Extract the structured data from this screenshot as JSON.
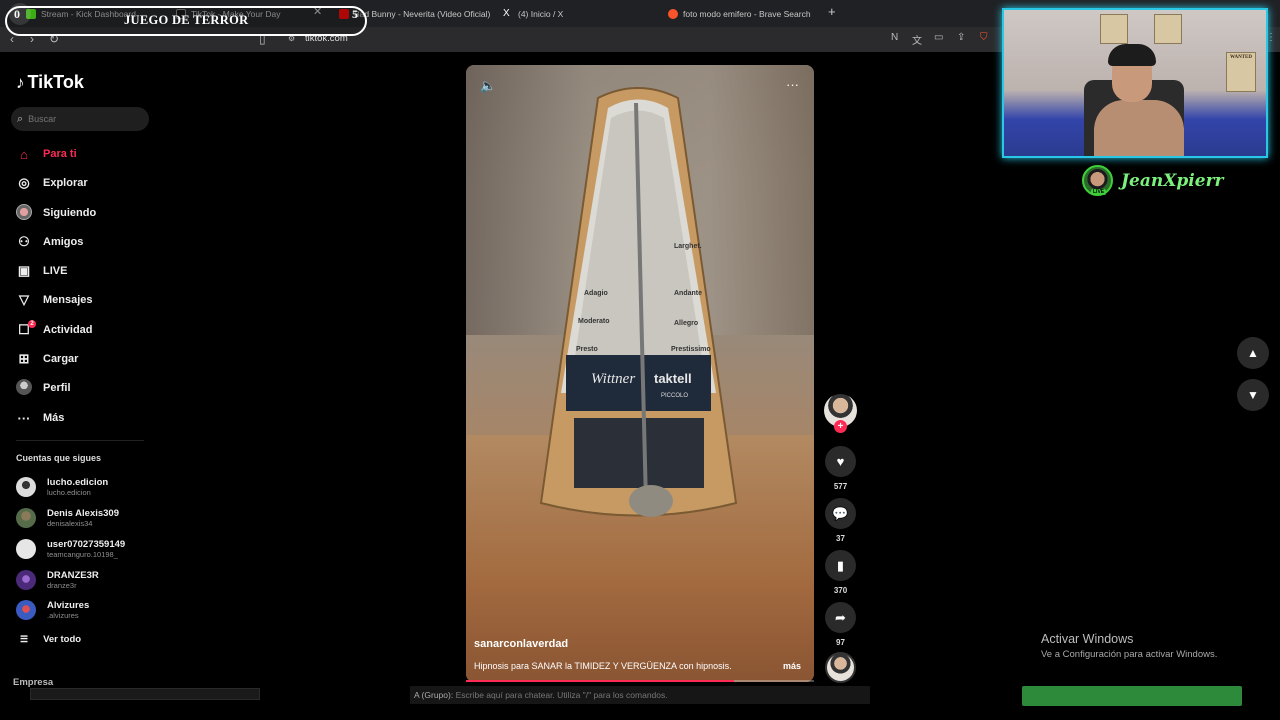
{
  "browser": {
    "tabs": [
      {
        "label": "Stream - Kick Dashboard",
        "color": "#53fc18"
      },
      {
        "label": "TikTok - Make Your Day",
        "color": "#ffffff"
      },
      {
        "label": "Bad Bunny - Neverita (Video Oficial)",
        "color": "#ff0000"
      },
      {
        "label": "(4) Inicio / X",
        "color": "#ffffff"
      },
      {
        "label": "foto modo emifero - Brave Search",
        "color": "#fb542b"
      }
    ],
    "url": "tiktok.com"
  },
  "overlay": {
    "score_left": "0",
    "title": "JUEGO DE TERROR",
    "score_right": "5"
  },
  "sidebar": {
    "logo": "TikTok",
    "search_placeholder": "Buscar",
    "nav": [
      {
        "label": "Para ti",
        "icon": "home-icon"
      },
      {
        "label": "Explorar",
        "icon": "compass-icon"
      },
      {
        "label": "Siguiendo",
        "icon": "avatar-icon"
      },
      {
        "label": "Amigos",
        "icon": "friends-icon"
      },
      {
        "label": "LIVE",
        "icon": "live-icon"
      },
      {
        "label": "Mensajes",
        "icon": "messages-icon"
      },
      {
        "label": "Actividad",
        "icon": "activity-icon",
        "badge": "2"
      },
      {
        "label": "Cargar",
        "icon": "upload-icon"
      },
      {
        "label": "Perfil",
        "icon": "profile-icon"
      },
      {
        "label": "Más",
        "icon": "more-icon"
      }
    ],
    "following_title": "Cuentas que sigues",
    "following": [
      {
        "name": "lucho.edicion",
        "handle": "lucho.edicion",
        "color": "#dcdcdc"
      },
      {
        "name": "Denis Alexis309",
        "handle": "denisalexis34",
        "color": "#556b4a"
      },
      {
        "name": "user07027359149",
        "handle": "teamcanguro.10198_",
        "color": "#e6e6e6"
      },
      {
        "name": "DRANZE3R",
        "handle": "dranze3r",
        "color": "#4b2a7a"
      },
      {
        "name": "Alvizures",
        "handle": ".alvizures",
        "color": "#3a5bbf"
      }
    ],
    "see_all": "Ver todo",
    "footer": "Empresa"
  },
  "video": {
    "username": "sanarconlaverdad",
    "description": "Hipnosis para SANAR la TIMIDEZ Y VERGÜENZA con hipnosis.",
    "more": "más",
    "progress": 0.77,
    "metronome_brand_left": "Wittner",
    "metronome_brand_right": "taktell",
    "metronome_model": "PICCOLO",
    "tempo_labels": [
      "Larghet.",
      "Andante",
      "Allegro",
      "Prestissimo",
      "Adagio",
      "Moderato",
      "Presto"
    ]
  },
  "actions": {
    "likes": "577",
    "comments": "37",
    "saves": "370",
    "shares": "97"
  },
  "webcam": {
    "streamer": "JeanXpierr",
    "live": "LIVE",
    "poster_text": "WANTED"
  },
  "windows": {
    "line1": "Activar Windows",
    "line2": "Ve a Configuración para activar Windows."
  },
  "chat": {
    "group": "A (Grupo):",
    "placeholder": "Escribe aquí para chatear. Utiliza \"/\" para los comandos."
  }
}
